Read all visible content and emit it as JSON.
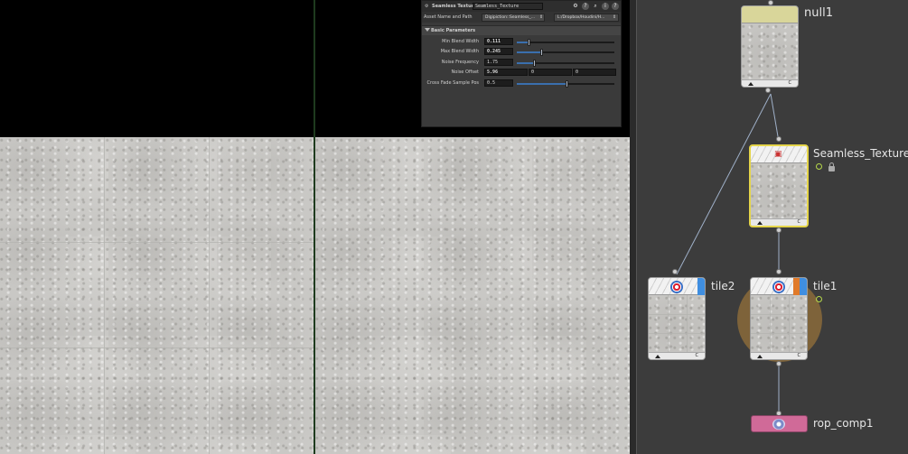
{
  "param_panel": {
    "node_type_label": "Seamless Texture",
    "node_name": "Seamless_Texture",
    "asset_label": "Asset Name and Path",
    "asset_name": "Digipiction::Seamless_...",
    "asset_path": "L:/Dropbox/Houdini/H...",
    "section_title": "Basic Parameters",
    "params": [
      {
        "label": "Min Blend Width",
        "value": "0.111",
        "slider_fraction": 0.11
      },
      {
        "label": "Max Blend Width",
        "value": "0.245",
        "slider_fraction": 0.245
      },
      {
        "label": "Noise Frequency",
        "value": "1.75",
        "slider_fraction": 0.175
      },
      {
        "label": "Noise Offset",
        "values": [
          "5.96",
          "0",
          "0"
        ]
      },
      {
        "label": "Cross Fade Sample Pos",
        "value": "0.5",
        "slider_fraction": 0.5
      }
    ],
    "header_icons": [
      "gear-icon",
      "help-circle-icon",
      "search-icon",
      "info-icon",
      "question-icon"
    ]
  },
  "network": {
    "nodes": [
      {
        "name": "null1"
      },
      {
        "name": "Seamless_Texture"
      },
      {
        "name": "tile2"
      },
      {
        "name": "tile1"
      },
      {
        "name": "rop_comp1"
      }
    ],
    "footer_flag": "C"
  },
  "colors": {
    "selected_outline": "#e5d54a",
    "rop_node": "#d06a98",
    "blue_flag": "#3f8ee0",
    "orange_flag": "#e07a2a",
    "display_glow": "#8a6a3a",
    "network_bg": "#3c3c3c"
  }
}
